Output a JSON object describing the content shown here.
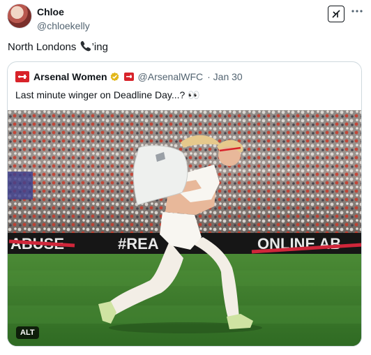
{
  "tweet": {
    "author_name": "Chloe",
    "author_handle": "@chloekelly",
    "text_before": "North Londons ",
    "text_after": "’ing",
    "inline_icon": "telephone-receiver-icon"
  },
  "quoted": {
    "name": "Arsenal Women",
    "handle": "@ArsenalWFC",
    "date": "· Jan 30",
    "text": "Last minute winger on Deadline Day...? 👀",
    "media": {
      "alt_badge": "ALT",
      "ad_boards": [
        "ABUSE",
        "#REA",
        "ONLINE AB"
      ]
    }
  },
  "colors": {
    "arsenal_red": "#d8232a",
    "verified_gold": "#e2b719",
    "pitch_green": "#3f7a2e"
  }
}
